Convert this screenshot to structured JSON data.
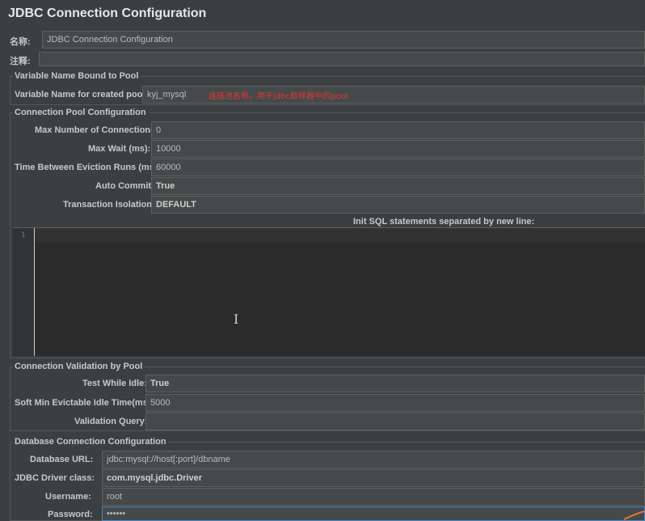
{
  "window": {
    "title": "JDBC Connection Configuration"
  },
  "name_row": {
    "label": "名称:",
    "value": "JDBC Connection Configuration"
  },
  "comment_row": {
    "label": "注释:",
    "value": ""
  },
  "variable_group": {
    "title": "Variable Name Bound to Pool",
    "label": "Variable Name for created pool:",
    "value": "kyj_mysql",
    "annotation": "连接池名称，用于jdbc取样器中的pool"
  },
  "pool_group": {
    "title": "Connection Pool Configuration",
    "max_connections": {
      "label": "Max Number of Connections:",
      "value": "0"
    },
    "max_wait": {
      "label": "Max Wait (ms):",
      "value": "10000"
    },
    "eviction_runs": {
      "label": "Time Between Eviction Runs (ms):",
      "value": "60000"
    },
    "auto_commit": {
      "label": "Auto Commit:",
      "value": "True"
    },
    "transaction_isolation": {
      "label": "Transaction Isolation:",
      "value": "DEFAULT"
    },
    "init_sql_label": "Init SQL statements separated by new line:",
    "editor_line_number": "1"
  },
  "validation_group": {
    "title": "Connection Validation by Pool",
    "test_while_idle": {
      "label": "Test While Idle:",
      "value": "True"
    },
    "soft_min_evictable": {
      "label": "Soft Min Evictable Idle Time(ms):",
      "value": "5000"
    },
    "validation_query": {
      "label": "Validation Query:",
      "value": ""
    }
  },
  "database_group": {
    "title": "Database Connection Configuration",
    "database_url": {
      "label": "Database URL:",
      "value": "jdbc:mysql://host[:port]/dbname"
    },
    "driver_class": {
      "label": "JDBC Driver class:",
      "value": "com.mysql.jdbc.Driver"
    },
    "username": {
      "label": "Username:",
      "value": "root"
    },
    "password": {
      "label": "Password:",
      "value": "••••••"
    }
  },
  "colors": {
    "background": "#3c3f41",
    "field": "#45494a",
    "editor": "#2b2b2b",
    "annotation": "#e0392f",
    "focus": "#4a88c7"
  }
}
